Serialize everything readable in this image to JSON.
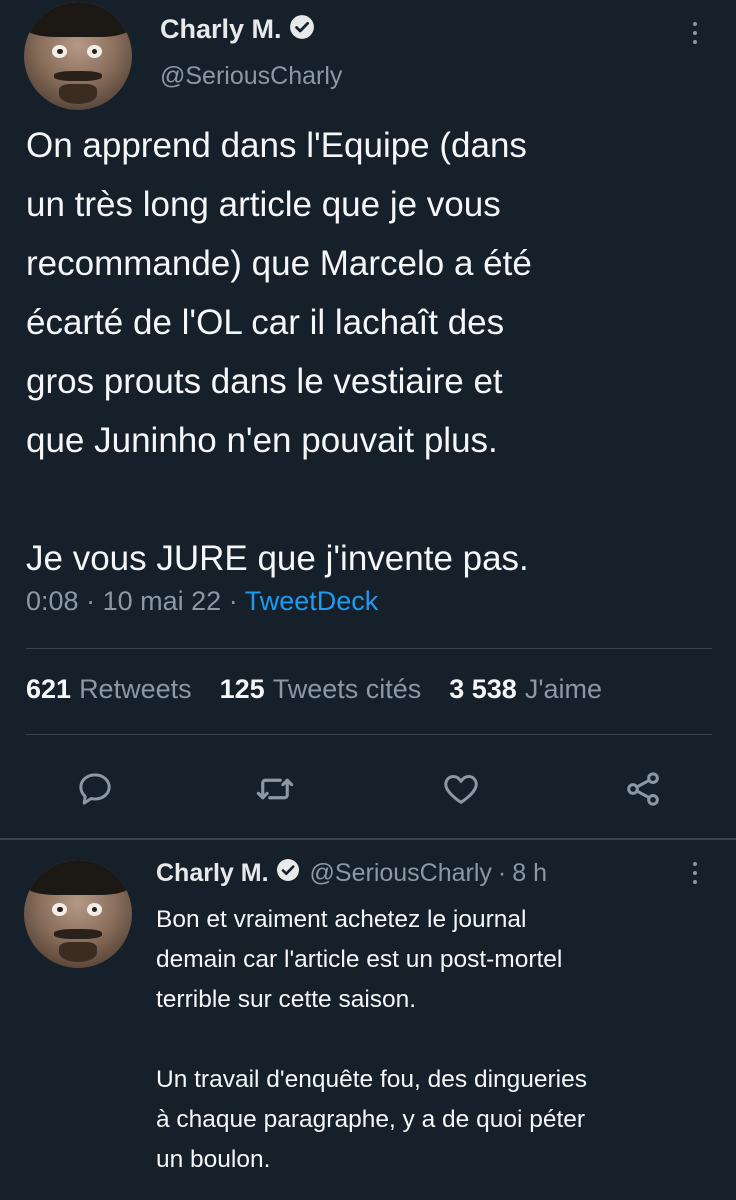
{
  "main_tweet": {
    "author_name": "Charly M.",
    "author_handle": "@SeriousCharly",
    "text": "On apprend dans l'Equipe (dans\nun très long article que je vous\nrecommande) que Marcelo a été\nécarté de l'OL car il lachaît des\ngros prouts dans le vestiaire et\nque Juninho n'en pouvait plus.\n\nJe vous JURE que j'invente pas.",
    "time": "0:08",
    "date": "10 mai 22",
    "separator": "·",
    "source": "TweetDeck",
    "stats": {
      "retweets_count": "621",
      "retweets_label": "Retweets",
      "quotes_count": "125",
      "quotes_label": "Tweets cités",
      "likes_count": "3 538",
      "likes_label": "J'aime"
    },
    "actions": [
      "reply-icon",
      "retweet-icon",
      "like-icon",
      "share-icon"
    ]
  },
  "reply_tweet": {
    "author_name": "Charly M.",
    "author_handle": "@SeriousCharly",
    "separator": "·",
    "age": "8 h",
    "text": "Bon et vraiment achetez le journal\ndemain car l'article est un post-mortel\nterrible sur cette saison.\n\nUn travail d'enquête fou, des dingueries\nà chaque paragraphe, y a de quoi péter\nun boulon."
  },
  "colors": {
    "background": "#15202b",
    "text": "#f4f6f7",
    "secondary": "#8b98a5",
    "accent": "#1d9bf0",
    "divider": "#38444d"
  }
}
